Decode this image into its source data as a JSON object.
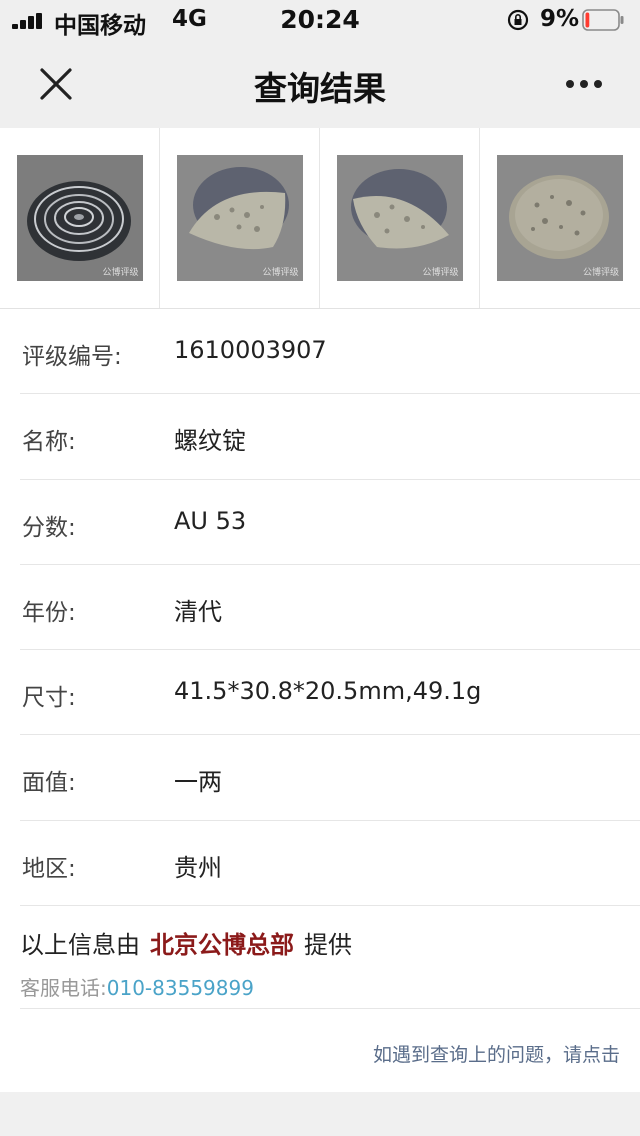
{
  "status_bar": {
    "carrier": "中国移动",
    "network": "4G",
    "time": "20:24",
    "battery_percent": "9%",
    "battery_level": 0.09,
    "battery_color": "#ff3b30",
    "icons": [
      "signal-icon",
      "rotation-lock-icon",
      "battery-icon"
    ]
  },
  "nav": {
    "title": "查询结果",
    "close_icon": "close-icon",
    "more_icon": "more-icon"
  },
  "thumbnails": [
    {
      "watermark": "公博评级"
    },
    {
      "watermark": "公博评级"
    },
    {
      "watermark": "公博评级"
    },
    {
      "watermark": "公博评级"
    }
  ],
  "info_rows": [
    {
      "label": "评级编号:",
      "value": "1610003907"
    },
    {
      "label": "名称:",
      "value": "螺纹锭"
    },
    {
      "label": "分数:",
      "value": "AU 53"
    },
    {
      "label": "年份:",
      "value": "清代"
    },
    {
      "label": "尺寸:",
      "value": "41.5*30.8*20.5mm,49.1g"
    },
    {
      "label": "面值:",
      "value": "一两"
    },
    {
      "label": "地区:",
      "value": "贵州"
    }
  ],
  "provider": {
    "prefix": "以上信息由",
    "org": "北京公博总部",
    "suffix": "提供",
    "service_label": "客服电话:",
    "phone": "010-83559899",
    "org_color": "#8b1a1a",
    "phone_color": "#4aa3c8"
  },
  "help_link": "如遇到查询上的问题，请点击"
}
